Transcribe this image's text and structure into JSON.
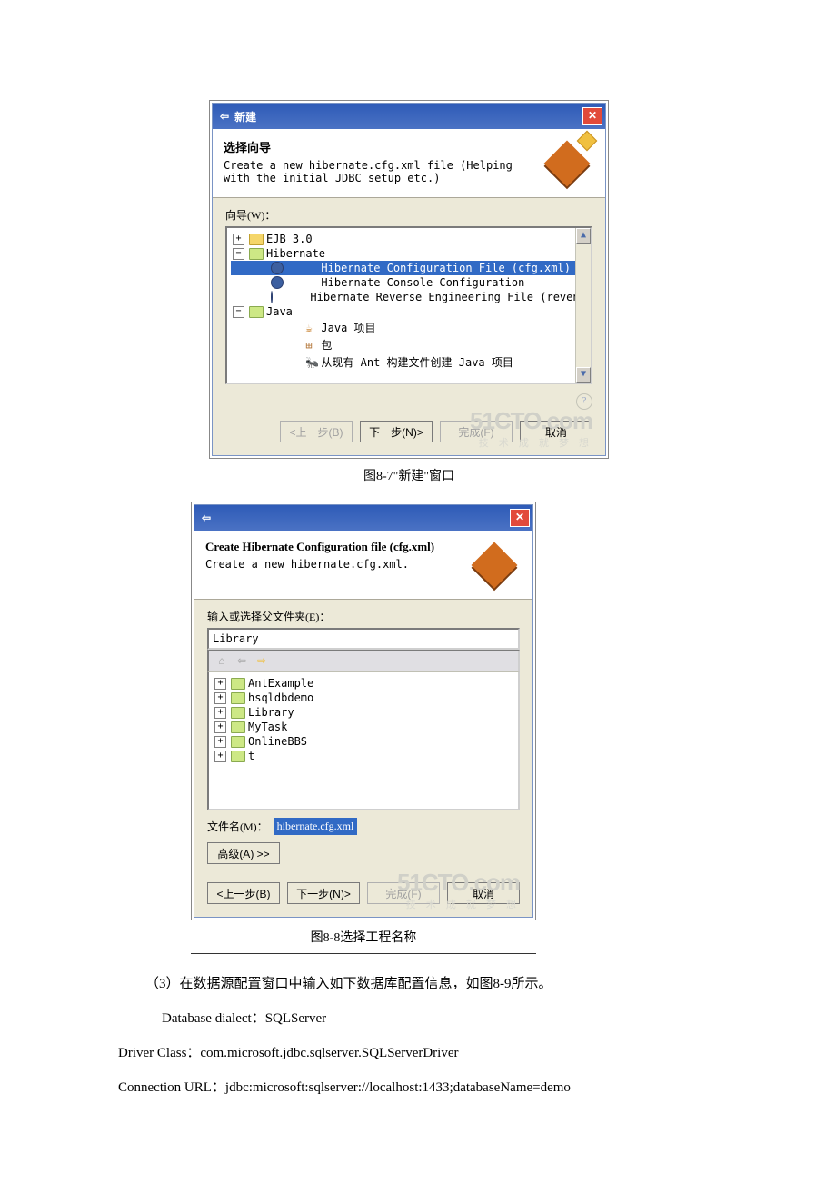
{
  "dialog1": {
    "title": "新建",
    "wizard_heading": "选择向导",
    "wizard_desc": "Create a new hibernate.cfg.xml file (Helping with the initial JDBC setup etc.)",
    "tree_label": "向导(W)：",
    "tree": {
      "ejb": "EJB 3.0",
      "hibernate": "Hibernate",
      "hib_cfg": "Hibernate Configuration File (cfg.xml)",
      "hib_console": "Hibernate Console Configuration",
      "hib_reveng": "Hibernate Reverse Engineering File (reveng.xml)",
      "java": "Java",
      "java_proj": "Java 项目",
      "pkg": "包",
      "ant": "从现有 Ant 构建文件创建 Java 项目"
    },
    "btn_prev": "<上一步(B)",
    "btn_next": "下一步(N)>",
    "btn_finish": "完成(F)",
    "btn_cancel": "取消"
  },
  "caption1": "图8-7\"新建\"窗口",
  "dialog2": {
    "wizard_heading": "Create Hibernate Configuration file (cfg.xml)",
    "wizard_desc": "Create a new hibernate.cfg.xml.",
    "parent_label": "输入或选择父文件夹(E)：",
    "parent_value": "Library",
    "tree": {
      "antex": "AntExample",
      "hsqldb": "hsqldbdemo",
      "library": "Library",
      "mytask": "MyTask",
      "onlinebbs": "OnlineBBS",
      "t": "t"
    },
    "file_label": "文件名(M)：",
    "file_value": "hibernate.cfg.xml",
    "btn_adv": "高级(A) >>",
    "btn_prev": "<上一步(B)",
    "btn_next": "下一步(N)>",
    "btn_finish": "完成(F)",
    "btn_cancel": "取消"
  },
  "caption2": "图8-8选择工程名称",
  "body": {
    "p1": "（3）在数据源配置窗口中输入如下数据库配置信息，如图8-9所示。",
    "p2": "Database dialect：SQLServer",
    "p3": "Driver Class：com.microsoft.jdbc.sqlserver.SQLServerDriver",
    "p4": "Connection URL：jdbc:microsoft:sqlserver://localhost:1433;databaseName=demo"
  },
  "watermark": {
    "main": "51CTO.com",
    "sub": "技 术 成 就 梦 想"
  }
}
